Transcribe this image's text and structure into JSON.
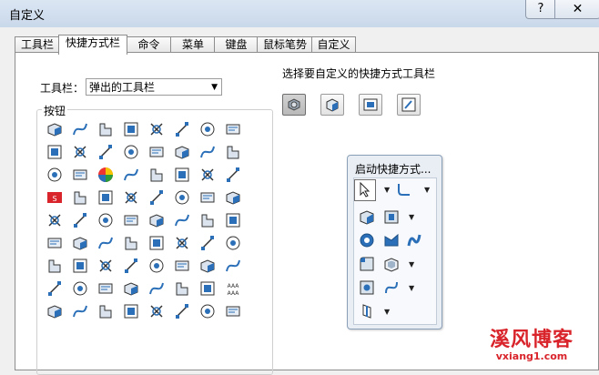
{
  "window": {
    "title": "自定义",
    "help_label": "?",
    "close_label": "✕"
  },
  "tabs": [
    {
      "label": "工具栏"
    },
    {
      "label": "快捷方式栏"
    },
    {
      "label": "命令"
    },
    {
      "label": "菜单"
    },
    {
      "label": "键盘"
    },
    {
      "label": "鼠标笔势"
    },
    {
      "label": "自定义"
    }
  ],
  "active_tab": "快捷方式栏",
  "toolbar_select": {
    "label": "工具栏：",
    "value": "弹出的工具栏",
    "arrow": "▼"
  },
  "buttons_group": {
    "title": "按钮",
    "icons": [
      "move-component-icon",
      "align-icon",
      "text-angle-icon",
      "extruded-boss-icon",
      "insert-note-icon",
      "spline-icon",
      "measure-icon",
      "crosshair-icon",
      "dimension-icon",
      "gear-hand-icon",
      "cube-icon",
      "bom-table-icon",
      "perspective-plane-icon",
      "hatch-icon",
      "file-i-icon",
      "blue-cube-icon",
      "target-icon",
      "cut-extrude-icon",
      "color-wheel-icon",
      "window-tab-icon",
      "filter-icon",
      "blank-panel-icon",
      "flatten-icon",
      "sketch-fillet-icon",
      "sm-icon",
      "curve-icon",
      "save-icon",
      "part-tree-icon",
      "rotate-arrows-icon",
      "table-grid-icon",
      "toolbox-icon",
      "magnifier-icon",
      "globe-icon",
      "decal-icon",
      "new-doc-icon",
      "open-folder-icon",
      "print-icon",
      "settings-gear-icon",
      "chamfer-corner-icon",
      "line-icon",
      "slot-icon",
      "straight-slot-icon",
      "circle-icon",
      "arc-slot-icon",
      "ellipse-icon",
      "spline-curve-icon",
      "corner-arc-icon",
      "box-icon",
      "mate-icon",
      "move-arrow-icon",
      "tree-structure-icon",
      "eye-icon",
      "arrow-hand-icon",
      "shell-icon",
      "frame-icon",
      "cube-edit-icon",
      "assembly-tree-icon",
      "assembly-add-icon",
      "assembly-view-icon",
      "table-tree-icon",
      "cube-mate-icon",
      "cylinder-icon",
      "swap-arrows-icon",
      "aaa-text-icon",
      "monitor-icon",
      "mate-check-icon",
      "hole-icon",
      "sheet-icon",
      "weld-icon",
      "cube-blue-icon",
      "pin-cube-icon",
      "building-icon"
    ]
  },
  "right_section": {
    "label": "选择要自定义的快捷方式工具栏",
    "selector_icons": [
      "part-shortcut-icon",
      "assembly-shortcut-icon",
      "drawing-shortcut-icon",
      "sketch-shortcut-icon"
    ]
  },
  "popup": {
    "title": "启动快捷方式...",
    "rows": [
      [
        "select-arrow-icon",
        "sketch-fillet-shortcut-icon"
      ],
      [
        "extrude-boss-shortcut-icon",
        "extrude-cut-shortcut-icon"
      ],
      [
        "revolve-icon",
        "sweep-icon",
        "loft-icon"
      ],
      [
        "fillet-icon",
        "shell-shortcut-icon"
      ],
      [
        "hole-wizard-icon",
        "spline-shortcut-icon"
      ],
      [
        "plane-icon"
      ]
    ]
  },
  "watermark": {
    "main": "溪风博客",
    "sub": "vxiang1.com"
  },
  "colors": {
    "accent_blue": "#2a6fb7",
    "watermark_red": "#d8242a"
  }
}
